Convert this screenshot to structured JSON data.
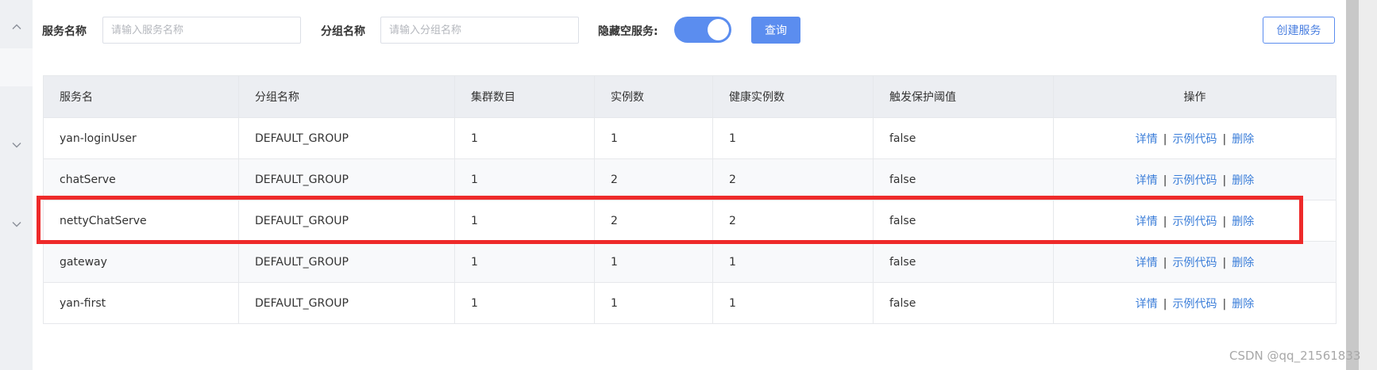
{
  "filters": {
    "service_name_label": "服务名称",
    "service_name_placeholder": "请输入服务名称",
    "group_name_label": "分组名称",
    "group_name_placeholder": "请输入分组名称",
    "hide_empty_label": "隐藏空服务:",
    "hide_empty_on": true,
    "query_label": "查询",
    "create_label": "创建服务"
  },
  "table": {
    "columns": [
      "服务名",
      "分组名称",
      "集群数目",
      "实例数",
      "健康实例数",
      "触发保护阈值",
      "操作"
    ],
    "actions": [
      "详情",
      "示例代码",
      "删除"
    ],
    "rows": [
      [
        "yan-loginUser",
        "DEFAULT_GROUP",
        "1",
        "1",
        "1",
        "false"
      ],
      [
        "chatServe",
        "DEFAULT_GROUP",
        "1",
        "2",
        "2",
        "false"
      ],
      [
        "nettyChatServe",
        "DEFAULT_GROUP",
        "1",
        "2",
        "2",
        "false"
      ],
      [
        "gateway",
        "DEFAULT_GROUP",
        "1",
        "1",
        "1",
        "false"
      ],
      [
        "yan-first",
        "DEFAULT_GROUP",
        "1",
        "1",
        "1",
        "false"
      ]
    ]
  },
  "watermark": "CSDN @qq_21561833",
  "colors": {
    "primary": "#5b8def",
    "link": "#3b7ed9",
    "highlight": "#ee2a2a"
  }
}
